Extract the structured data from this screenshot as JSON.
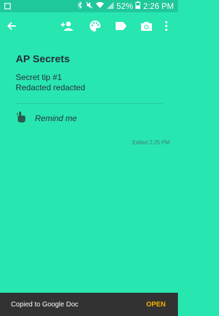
{
  "status_bar": {
    "battery_percent": "52%",
    "time": "2:26 PM",
    "icons": [
      "bluetooth-icon",
      "mute-icon",
      "wifi-icon",
      "signal-icon",
      "battery-icon"
    ]
  },
  "toolbar": {
    "icons": [
      "back-arrow-icon",
      "add-person-icon",
      "palette-icon",
      "label-icon",
      "camera-icon",
      "more-vert-icon"
    ]
  },
  "note": {
    "title": "AP Secrets",
    "body_line1": "Secret tip #1",
    "body_line2": "Redacted redacted",
    "reminder_label": "Remind me",
    "edited": "Edited 2:25 PM"
  },
  "snackbar": {
    "message": "Copied to Google Doc",
    "action": "OPEN"
  },
  "colors": {
    "background": "#28e6b0",
    "status_bar": "#1fc89a",
    "snackbar": "#323232",
    "snackbar_action": "#f5b400"
  }
}
